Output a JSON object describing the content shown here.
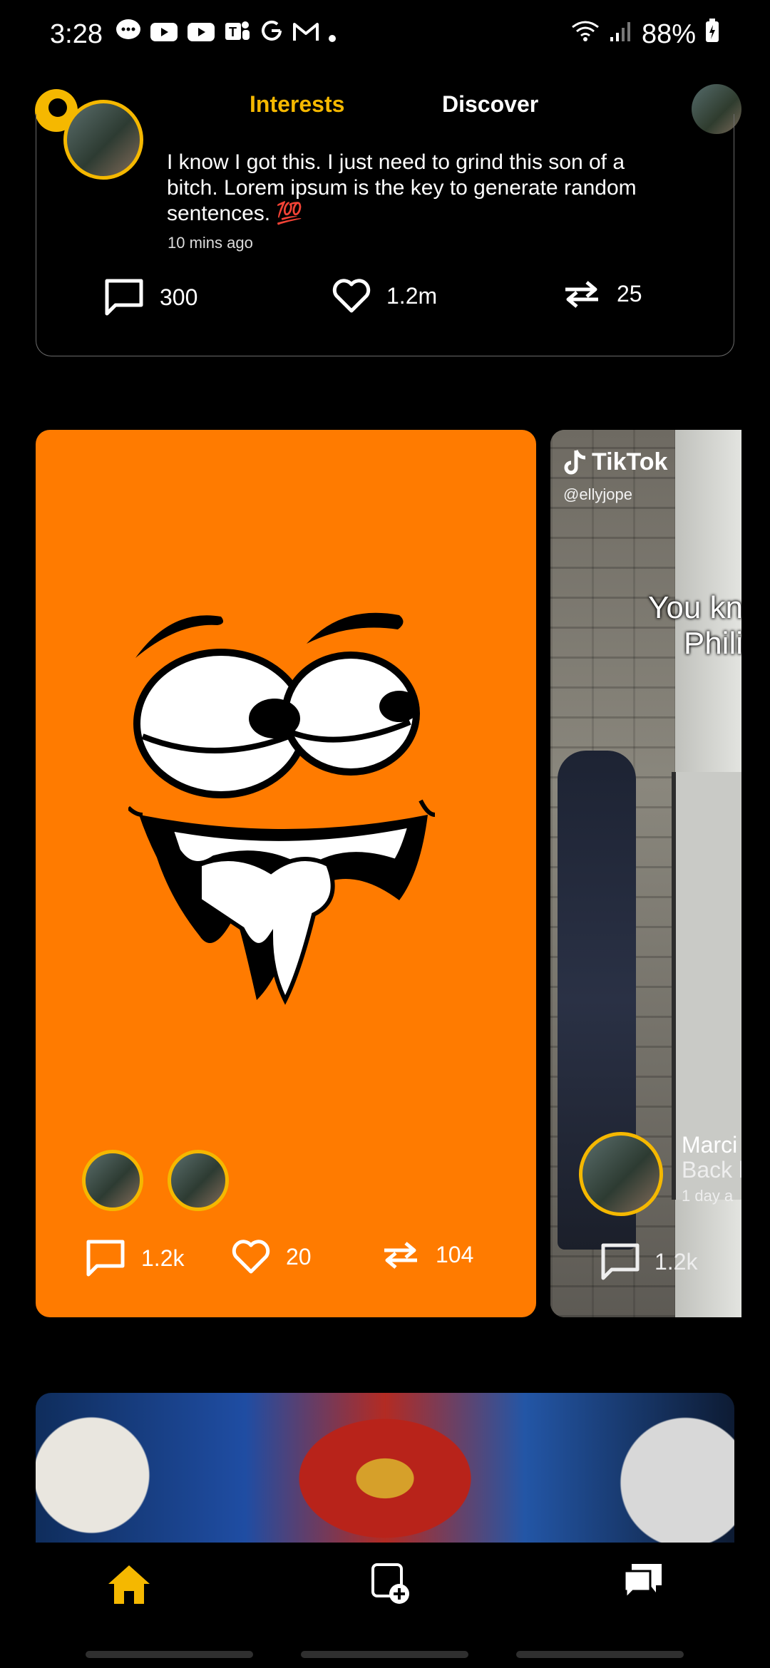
{
  "status_bar": {
    "time": "3:28",
    "battery": "88%",
    "notification_icons": [
      "chat-icon",
      "youtube-icon",
      "youtube-icon",
      "teams-icon",
      "google-icon",
      "gmail-icon",
      "dot-icon"
    ]
  },
  "top_nav": {
    "tabs": [
      {
        "label": "Interests",
        "active": true
      },
      {
        "label": "Discover",
        "active": false
      }
    ],
    "accent_color": "#f5b800"
  },
  "post": {
    "text": "I know I got this. I just need to grind this son of a bitch. Lorem ipsum is the key to generate random sentences. 💯",
    "time": "10 mins ago",
    "comments": "300",
    "likes": "1.2m",
    "reposts": "25"
  },
  "featured_card": {
    "background_color": "#ff7b00",
    "comments": "1.2k",
    "likes": "20",
    "reposts": "104"
  },
  "side_card": {
    "tiktok_label": "TikTok",
    "handle": "@ellyjope",
    "caption_line1": "You kn",
    "caption_line2": "Phili",
    "name": "Marci",
    "subtitle": "Back b",
    "time": "1 day a",
    "comments": "1.2k"
  },
  "bottom_nav": {
    "items": [
      "home-icon",
      "create-post-icon",
      "messages-icon"
    ]
  }
}
